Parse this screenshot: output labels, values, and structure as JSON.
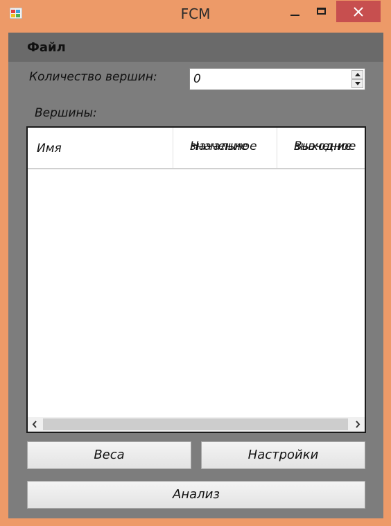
{
  "window": {
    "title": "FCM",
    "icons": {
      "app": "app-icon",
      "minimize": "minimize-icon",
      "maximize": "maximize-icon",
      "close": "close-icon"
    }
  },
  "menu": {
    "file": "Файл"
  },
  "form": {
    "count_label": "Количество вершин:",
    "count_value": "0",
    "nodes_label": "Вершины:"
  },
  "grid": {
    "columns": [
      {
        "line1": "Имя",
        "line2": ""
      },
      {
        "line1": "Начальное",
        "line2": "значение"
      },
      {
        "line1": "Выходное",
        "line2": "значение"
      }
    ],
    "rows": []
  },
  "buttons": {
    "weights": "Веса",
    "settings": "Настройки",
    "analysis": "Анализ"
  },
  "colors": {
    "frame": "#ed9a68",
    "client": "#7d7d7d",
    "menubar": "#6a6a6a",
    "close": "#c74f4f"
  }
}
